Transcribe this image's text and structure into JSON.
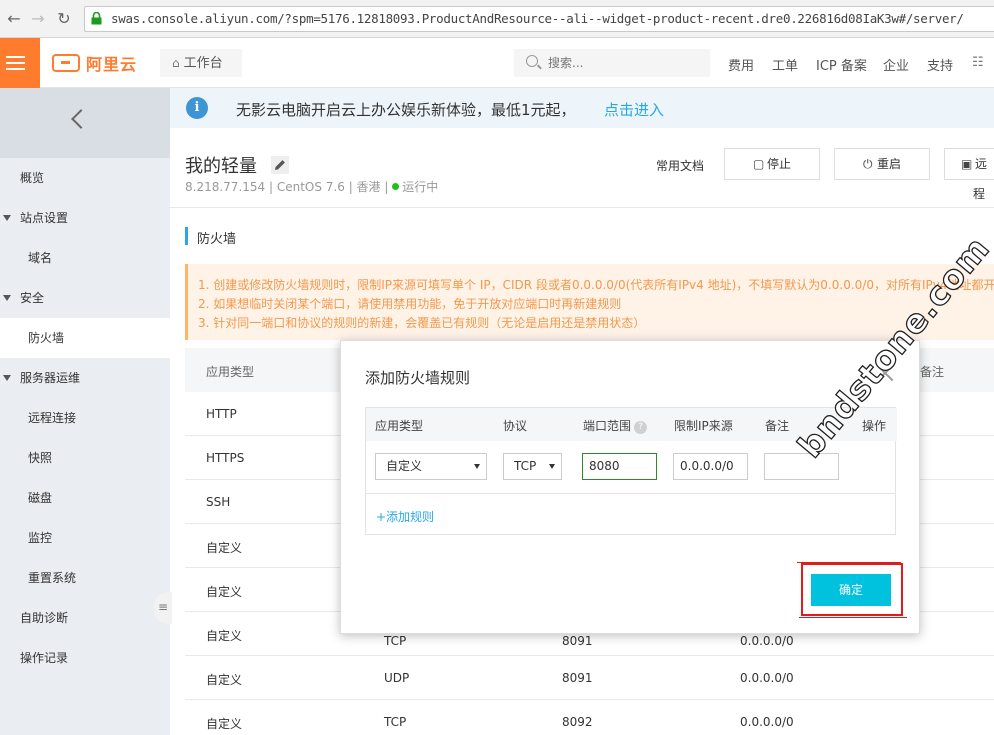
{
  "browser": {
    "url": "swas.console.aliyun.com/?spm=5176.12818093.ProductAndResource--ali--widget-product-recent.dre0.226816d08IaK3w#/server/"
  },
  "header": {
    "logo_text": "阿里云",
    "workbench_label": "工作台",
    "search_placeholder": "搜索...",
    "nav": [
      "费用",
      "工单",
      "ICP 备案",
      "企业",
      "支持"
    ]
  },
  "sidebar": {
    "items": [
      {
        "label": "概览"
      },
      {
        "label": "站点设置"
      },
      {
        "label": "域名"
      },
      {
        "label": "安全"
      },
      {
        "label": "防火墙"
      },
      {
        "label": "服务器运维"
      },
      {
        "label": "远程连接"
      },
      {
        "label": "快照"
      },
      {
        "label": "磁盘"
      },
      {
        "label": "监控"
      },
      {
        "label": "重置系统"
      },
      {
        "label": "自助诊断"
      },
      {
        "label": "操作记录"
      }
    ],
    "active": "防火墙"
  },
  "notice": {
    "text": "无影云电脑开启云上办公娱乐新体验，最低1元起，",
    "link": "点击进入"
  },
  "server": {
    "title": "我的轻量",
    "ip": "8.218.77.154",
    "os": "CentOS 7.6",
    "region": "香港",
    "status": "运行中",
    "status_color": "#1dc11d"
  },
  "actions": {
    "docs": "常用文档",
    "stop": "停止",
    "restart": "重启",
    "remote": "远程"
  },
  "firewall": {
    "section_title": "防火墙",
    "warnings": [
      "1. 创建或修改防火墙规则时，限制IP来源可填写单个 IP，CIDR 段或者0.0.0.0/0(代表所有IPv4 地址)，不填写默认为0.0.0.0/0，对所有IPv4地址都开放",
      "2. 如果想临时关闭某个端口，请使用禁用功能，免于开放对应端口时再新建规则",
      "3. 针对同一端口和协议的规则的新建，会覆盖已有规则（无论是启用还是禁用状态）"
    ],
    "columns": [
      "应用类型",
      "备注"
    ],
    "rows": [
      {
        "type": "HTTP",
        "protocol": "",
        "port": "",
        "source": ""
      },
      {
        "type": "HTTPS",
        "protocol": "",
        "port": "",
        "source": ""
      },
      {
        "type": "SSH",
        "protocol": "",
        "port": "",
        "source": ""
      },
      {
        "type": "自定义",
        "protocol": "",
        "port": "",
        "source": ""
      },
      {
        "type": "自定义",
        "protocol": "",
        "port": "",
        "source": ""
      },
      {
        "type": "自定义",
        "protocol": "TCP",
        "port": "8091",
        "source": "0.0.0.0/0"
      },
      {
        "type": "自定义",
        "protocol": "UDP",
        "port": "8091",
        "source": "0.0.0.0/0"
      },
      {
        "type": "自定义",
        "protocol": "TCP",
        "port": "8092",
        "source": "0.0.0.0/0"
      }
    ]
  },
  "dialog": {
    "title": "添加防火墙规则",
    "columns": [
      "应用类型",
      "协议",
      "端口范围",
      "限制IP来源",
      "备注",
      "操作"
    ],
    "rule": {
      "type": "自定义",
      "protocol": "TCP",
      "port": "8080",
      "source": "0.0.0.0/0",
      "remark": ""
    },
    "add_rule": "+添加规则",
    "confirm": "确定"
  },
  "watermark": "bndstone.com",
  "colors": {
    "accent": "#ff7c2e",
    "primary": "#00c1de",
    "link": "#26a8e6",
    "warning_text": "#f3984c"
  }
}
